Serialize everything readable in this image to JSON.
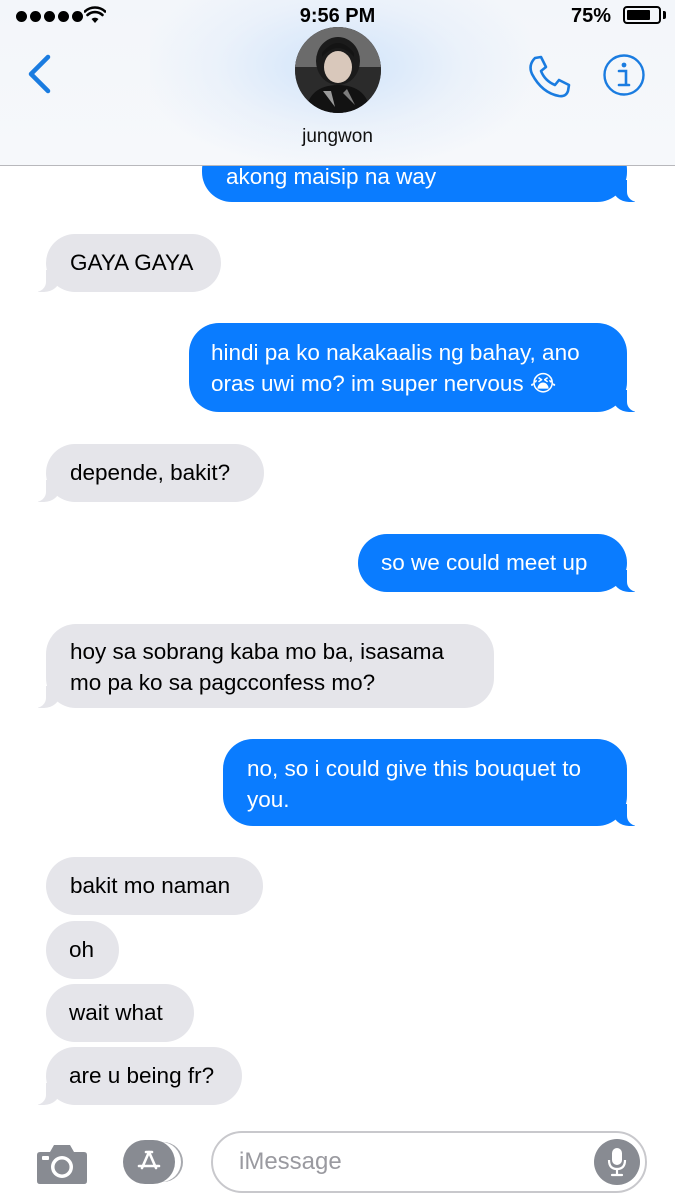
{
  "status_bar": {
    "time": "9:56 PM",
    "battery_percent": "75%",
    "battery_level": 0.75,
    "signal_bars": 5
  },
  "header": {
    "contact_name": "jungwon",
    "accent_color": "#1a7ce0"
  },
  "messages": [
    {
      "from": "me",
      "text": "akong maisip na way"
    },
    {
      "from": "them",
      "text": "GAYA GAYA"
    },
    {
      "from": "me",
      "text": "hindi pa ko nakakaalis ng bahay, ano oras uwi mo? im super nervous 😭"
    },
    {
      "from": "them",
      "text": "depende, bakit?"
    },
    {
      "from": "me",
      "text": "so we could meet up"
    },
    {
      "from": "them",
      "text": "hoy sa sobrang kaba mo ba, isasama mo pa ko sa pagcconfess mo?"
    },
    {
      "from": "me",
      "text": "no, so i could give this bouquet to you."
    },
    {
      "from": "them",
      "text": "bakit mo naman"
    },
    {
      "from": "them",
      "text": "oh"
    },
    {
      "from": "them",
      "text": "wait what"
    },
    {
      "from": "them",
      "text": "are u being fr?"
    }
  ],
  "colors": {
    "outgoing_bubble": "#0a7cff",
    "incoming_bubble": "#e5e5ea"
  },
  "input": {
    "placeholder": "iMessage",
    "value": ""
  },
  "icons": [
    "back-chevron-icon",
    "phone-icon",
    "info-icon",
    "camera-icon",
    "app-store-icon",
    "microphone-icon",
    "wifi-icon",
    "battery-icon"
  ]
}
